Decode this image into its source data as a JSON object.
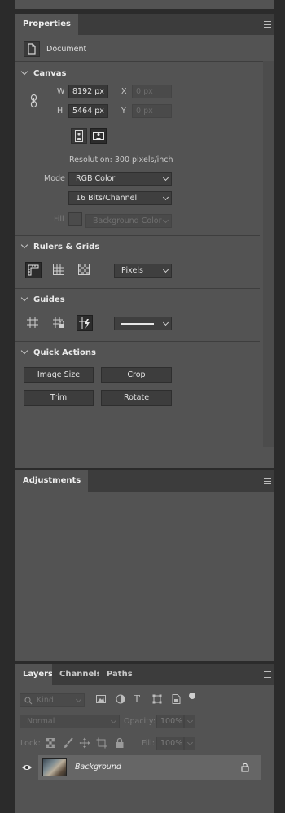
{
  "properties_panel": {
    "tab_label": "Properties",
    "document_label": "Document",
    "canvas": {
      "title": "Canvas",
      "w_label": "W",
      "w_value": "8192 px",
      "h_label": "H",
      "h_value": "5464 px",
      "x_label": "X",
      "x_placeholder": "0 px",
      "y_label": "Y",
      "y_placeholder": "0 px",
      "resolution": "Resolution: 300 pixels/inch",
      "mode_label": "Mode",
      "mode_value": "RGB Color",
      "bits_value": "16 Bits/Channel",
      "fill_label": "Fill",
      "fill_value": "Background Color"
    },
    "rulers_grids": {
      "title": "Rulers & Grids",
      "units_value": "Pixels"
    },
    "guides": {
      "title": "Guides"
    },
    "quick_actions": {
      "title": "Quick Actions",
      "image_size": "Image Size",
      "crop": "Crop",
      "trim": "Trim",
      "rotate": "Rotate"
    }
  },
  "adjustments_panel": {
    "tab_label": "Adjustments"
  },
  "layers_panel": {
    "tabs": [
      "Layers",
      "Channels",
      "Paths"
    ],
    "kind_filter": "Kind",
    "blend_mode": "Normal",
    "opacity_label": "Opacity:",
    "opacity_value": "100%",
    "lock_label": "Lock:",
    "fill_label": "Fill:",
    "fill_value": "100%",
    "layers": [
      {
        "name": "Background",
        "visible": true,
        "locked": true
      }
    ]
  },
  "colors": {
    "app_bg": "#2b2b2b",
    "panel_bg": "#535353",
    "tabbar_bg": "#3c3c3c",
    "input_bg": "#383838",
    "text": "#d6d6d6"
  }
}
